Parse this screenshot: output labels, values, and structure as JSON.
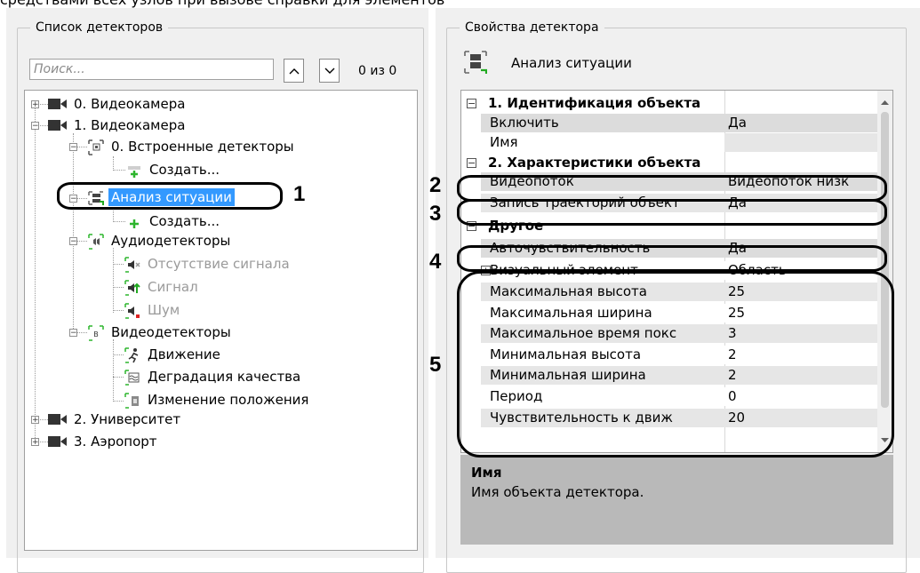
{
  "top_fragment_text": "средствами всех узлов при вызове справки для элементов",
  "left_panel": {
    "title": "Список детекторов",
    "search_placeholder": "Поиск...",
    "search_value": "",
    "prev_icon": "chevron-up-icon",
    "next_icon": "chevron-down-icon",
    "counter": "0 из 0",
    "tree": {
      "cam0": "0. Видеокамера",
      "cam1": "1. Видеокамера",
      "builtin": "0. Встроенные детекторы",
      "create1": "Создать...",
      "situation": "Анализ ситуации",
      "create2": "Создать...",
      "audio": "Аудиодетекторы",
      "no_signal": "Отсутствие сигнала",
      "signal": "Сигнал",
      "noise": "Шум",
      "video": "Видеодетекторы",
      "motion": "Движение",
      "degradation": "Деградация качества",
      "position": "Изменение положения",
      "cam2": "2. Университет",
      "cam3": "3. Аэропорт"
    }
  },
  "right_panel": {
    "title": "Свойства детектора",
    "detector_name": "Анализ ситуации",
    "categories": {
      "c1": "1. Идентификация объекта",
      "c2": "2. Характеристики объекта",
      "c3": "Другое"
    },
    "rows": {
      "enable": {
        "name": "Включить",
        "value": "Да"
      },
      "name": {
        "name": "Имя",
        "value": ""
      },
      "stream": {
        "name": "Видеопоток",
        "value": "Видеопоток низк"
      },
      "track": {
        "name": "Запись траекторий объект",
        "value": "Да"
      },
      "autosens": {
        "name": "Авточувствительность",
        "value": "Да"
      },
      "visual": {
        "name": "Визуальный элемент",
        "value": "Область"
      },
      "maxh": {
        "name": "Максимальная высота",
        "value": "25"
      },
      "maxw": {
        "name": "Максимальная ширина",
        "value": "25"
      },
      "maxtime": {
        "name": "Максимальное время покс",
        "value": "3"
      },
      "minh": {
        "name": "Минимальная высота",
        "value": "2"
      },
      "minw": {
        "name": "Минимальная ширина",
        "value": "2"
      },
      "period": {
        "name": "Период",
        "value": "0"
      },
      "sens": {
        "name": "Чувствительность к движ",
        "value": "20"
      }
    },
    "description": {
      "title": "Имя",
      "text": "Имя объекта детектора."
    }
  },
  "callouts": {
    "n1": "1",
    "n2": "2",
    "n3": "3",
    "n4": "4",
    "n5": "5"
  },
  "colors": {
    "selection": "#3399ff",
    "panel": "#f0f0f0",
    "description_bg": "#b9b9b9",
    "add_icon": "#2db52d",
    "marker_green": "#22aa22",
    "marker_red": "#dd2222"
  }
}
